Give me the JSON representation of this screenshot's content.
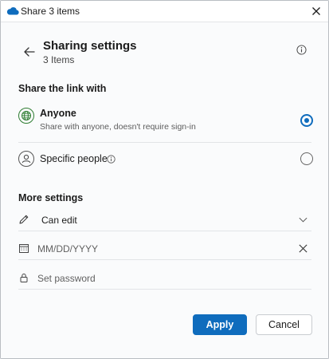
{
  "window": {
    "title": "Share 3 items"
  },
  "header": {
    "title": "Sharing settings",
    "subtitle": "3 Items"
  },
  "share_section": {
    "label": "Share the link with",
    "options": [
      {
        "title": "Anyone",
        "description": "Share with anyone, doesn't require sign-in",
        "selected": true,
        "icon": "globe-icon"
      },
      {
        "title": "Specific people",
        "selected": false,
        "icon": "person-icon"
      }
    ]
  },
  "more_settings": {
    "label": "More settings",
    "permission": {
      "value": "Can edit",
      "icon": "pencil-icon"
    },
    "expiry_date": {
      "placeholder": "MM/DD/YYYY",
      "icon": "calendar-icon"
    },
    "password": {
      "placeholder": "Set password",
      "icon": "lock-icon"
    }
  },
  "actions": {
    "apply_label": "Apply",
    "cancel_label": "Cancel"
  },
  "colors": {
    "accent": "#0f6cbd",
    "globe": "#2e7d32",
    "cloud": "#0f6cbd"
  }
}
